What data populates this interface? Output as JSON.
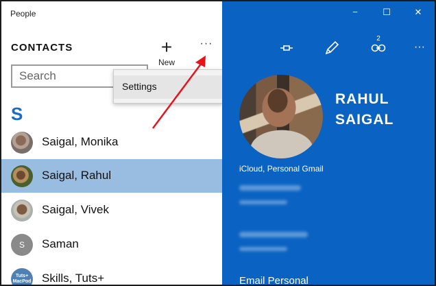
{
  "window": {
    "title": "People",
    "controls": {
      "minimize": "−",
      "maximize": "☐",
      "close": "✕"
    }
  },
  "left": {
    "section_title": "CONTACTS",
    "new_label": "New",
    "new_icon": "+",
    "more_icon": "···",
    "search_placeholder": "Search",
    "menu": {
      "items": [
        {
          "label": "Settings"
        }
      ]
    },
    "group_letter": "S",
    "contacts": [
      {
        "name": "Saigal, Monika",
        "selected": false
      },
      {
        "name": "Saigal, Rahul",
        "selected": true
      },
      {
        "name": "Saigal, Vivek",
        "selected": false
      },
      {
        "name": "Saman",
        "selected": false,
        "initial": "S"
      },
      {
        "name": "Skills, Tuts+",
        "selected": false,
        "avatar_text": "Tuts+ MacPod"
      }
    ]
  },
  "right": {
    "toolbar": {
      "link_count": "2",
      "more_icon": "···"
    },
    "contact_name_first": "RAHUL",
    "contact_name_last": "SAIGAL",
    "source": "iCloud, Personal Gmail",
    "email_label": "Email Personal"
  },
  "colors": {
    "accent_blue": "#0a63c2",
    "selection": "#98bde0",
    "letter_blue": "#1a6ac6",
    "annotation_arrow": "#e8121b"
  }
}
